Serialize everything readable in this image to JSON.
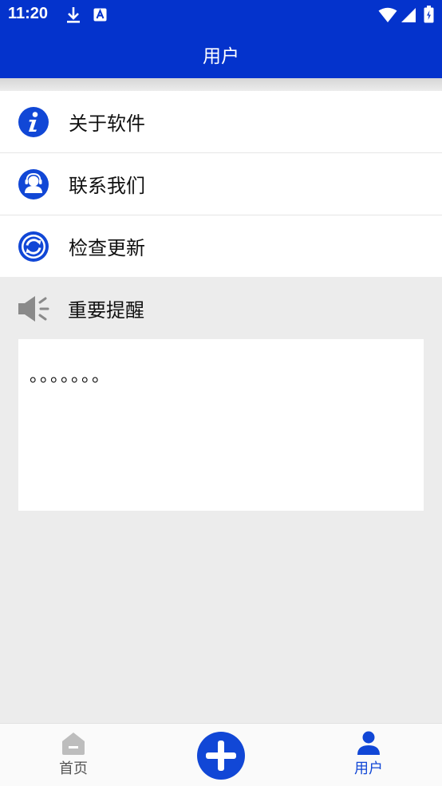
{
  "status_bar": {
    "time": "11:20",
    "icons": [
      "download-icon",
      "a-badge-icon",
      "wifi-icon",
      "signal-icon",
      "battery-icon"
    ]
  },
  "header": {
    "title": "用户"
  },
  "menu": {
    "items": [
      {
        "label": "关于软件",
        "icon": "info-icon"
      },
      {
        "label": "联系我们",
        "icon": "contact-icon"
      },
      {
        "label": "检查更新",
        "icon": "refresh-icon"
      }
    ]
  },
  "notice": {
    "title": "重要提醒",
    "icon": "speaker-icon",
    "text": "。。。。。。。"
  },
  "bottom_nav": {
    "home_label": "首页",
    "add_icon": "plus-icon",
    "user_label": "用户"
  },
  "colors": {
    "primary": "#0433cc",
    "accent": "#1147d6",
    "background": "#ececec"
  }
}
